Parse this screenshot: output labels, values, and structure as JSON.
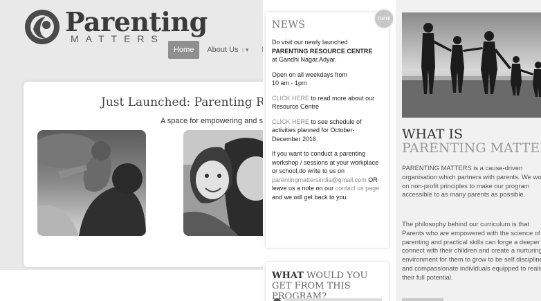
{
  "header": {
    "logo_word": "Parenting",
    "logo_sub": "MATTERS"
  },
  "nav": {
    "items": [
      {
        "label": "Home",
        "active": true
      },
      {
        "label": "About Us",
        "has_dropdown": true
      },
      {
        "label": "Pr"
      }
    ]
  },
  "slider": {
    "title": "Just Launched: Parenting Resou",
    "subtitle": "A space for empowering and su",
    "photo_labels": [
      "photo-father-child",
      "photo-mother-child"
    ],
    "dots": [
      true,
      false,
      false
    ]
  },
  "news": {
    "badge": "new",
    "title": "NEWS",
    "p1_line1": "Do visit our newly launched",
    "p1_bold": "PARENTING RESOURCE CENTRE",
    "p1_line3": "at Gandhi Nagar,Adyar.",
    "p2_line1": "Open on all weekdays from",
    "p2_line2": " 10 am - 1pm",
    "p3_link": "CLICK HERE",
    "p3_text": " to read more about our Resource Centre",
    "p4_link": "CLICK HERE",
    "p4_text": " to see schedule of activities planned for October-December 2016.",
    "p5_text1": "If you want to conduct a parenting workshop / sessions at your workplace or school,do write to us on ",
    "p5_email": "parentingmattersindia@gmail.com",
    "p5_text2": " OR leave us a note on our ",
    "p5_link": "contact us page",
    "p5_text3": " and we will get back to you."
  },
  "program": {
    "title_strong": "WHAT",
    "title_rest": " WOULD YOU GET FROM THIS PROGRAM?"
  },
  "about": {
    "title_line1": "WHAT IS",
    "title_line2": "PARENTING MATTERS?",
    "p1": "PARENTING MATTERS is a cause-driven organisation which partners with parents. We work on non-profit principles to make our program accessible to as many parents as possible.",
    "p2": "The philosophy behind our curriculum is that Parents who are empowered with the science of parenting and practical skills can forge a deeper connect with their children and create a nurturing environment for them to grow to be self disciplined and compassionate individuals equipped to realise their full potential."
  }
}
